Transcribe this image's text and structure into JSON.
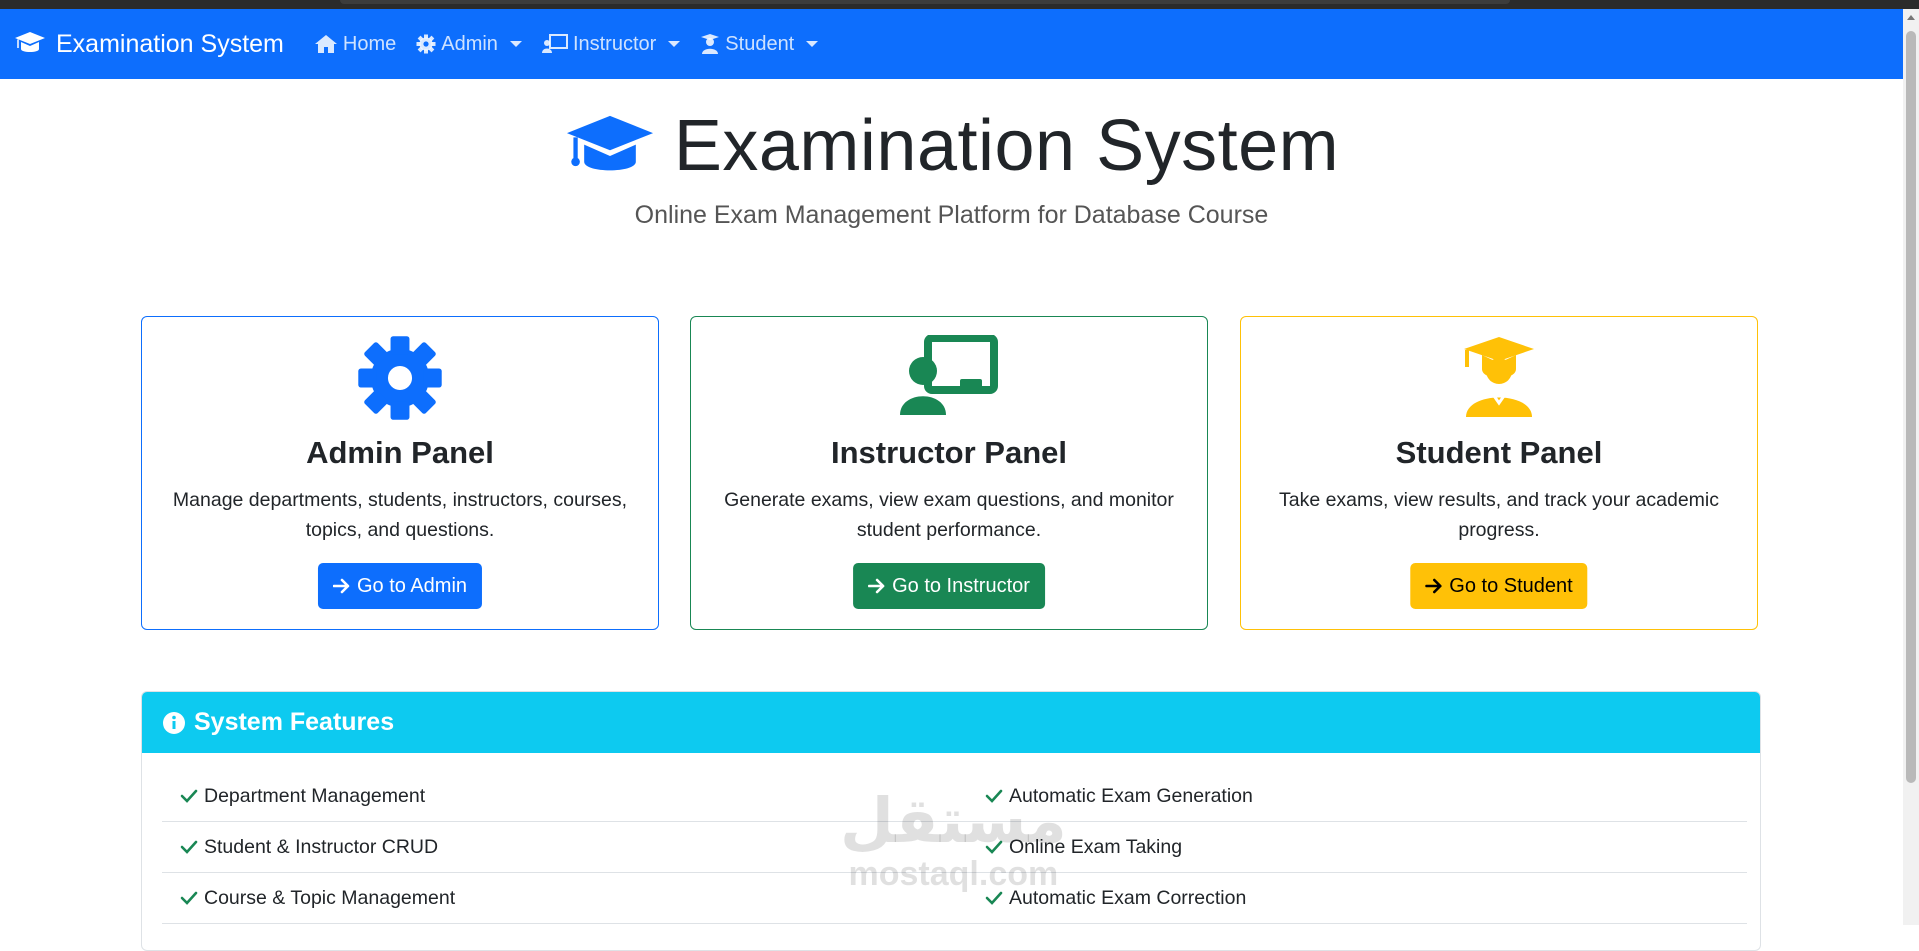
{
  "navbar": {
    "brand": "Examination System",
    "items": [
      {
        "label": "Home",
        "icon": "home-icon",
        "dropdown": false
      },
      {
        "label": "Admin",
        "icon": "gear-icon",
        "dropdown": true
      },
      {
        "label": "Instructor",
        "icon": "chalkboard-teacher-icon",
        "dropdown": true
      },
      {
        "label": "Student",
        "icon": "user-graduate-icon",
        "dropdown": true
      }
    ]
  },
  "hero": {
    "title": "Examination System",
    "subtitle": "Online Exam Management Platform for Database Course"
  },
  "panels": {
    "admin": {
      "title": "Admin Panel",
      "description": "Manage departments, students, instructors, courses, topics, and questions.",
      "button": "Go to Admin",
      "color": "#0d6efd"
    },
    "instructor": {
      "title": "Instructor Panel",
      "description": "Generate exams, view exam questions, and monitor student performance.",
      "button": "Go to Instructor",
      "color": "#198754"
    },
    "student": {
      "title": "Student Panel",
      "description": "Take exams, view results, and track your academic progress.",
      "button": "Go to Student",
      "color": "#ffc107"
    }
  },
  "features": {
    "header": "System Features",
    "left": [
      "Department Management",
      "Student & Instructor CRUD",
      "Course & Topic Management"
    ],
    "right": [
      "Automatic Exam Generation",
      "Online Exam Taking",
      "Automatic Exam Correction"
    ]
  },
  "watermark": {
    "arabic": "مستقل",
    "latin": "mostaql.com"
  }
}
